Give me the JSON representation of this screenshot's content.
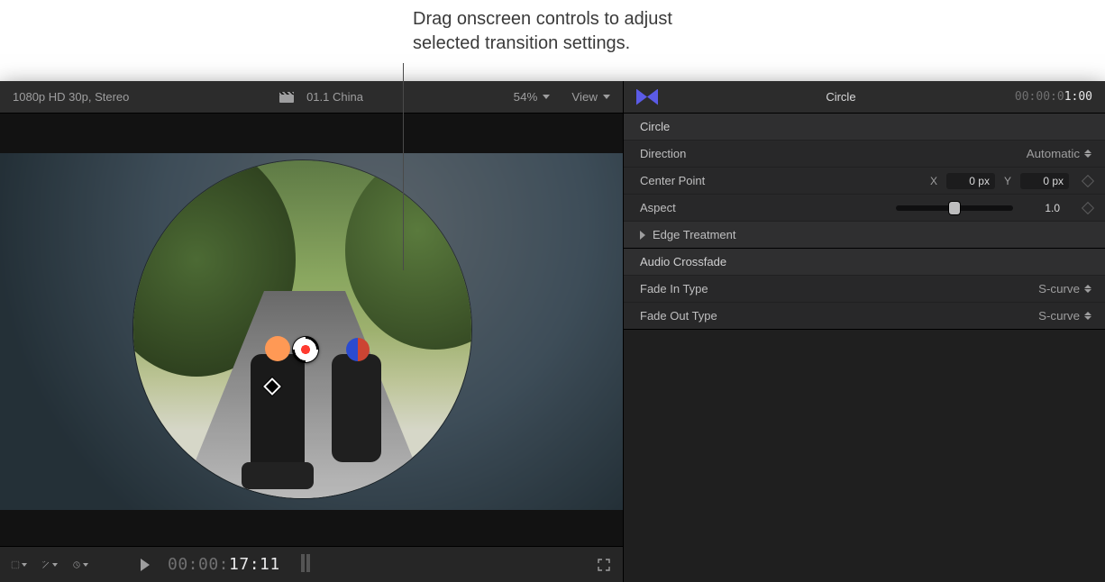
{
  "annotation": "Drag onscreen controls to adjust\nselected transition settings.",
  "viewer": {
    "format": "1080p HD 30p, Stereo",
    "clip_name": "01.1 China",
    "zoom": "54%",
    "view_label": "View",
    "timecode_dim": "00:00:",
    "timecode_hl": "17:11"
  },
  "inspector": {
    "title": "Circle",
    "tc_dim": "00:00:0",
    "tc_hl": "1:00",
    "sections": {
      "circle": {
        "heading": "Circle",
        "direction_label": "Direction",
        "direction_value": "Automatic",
        "center_label": "Center Point",
        "center_x_label": "X",
        "center_x_value": "0 px",
        "center_y_label": "Y",
        "center_y_value": "0 px",
        "aspect_label": "Aspect",
        "aspect_value": "1.0",
        "edge_label": "Edge Treatment"
      },
      "audio": {
        "heading": "Audio Crossfade",
        "fadein_label": "Fade In Type",
        "fadein_value": "S-curve",
        "fadeout_label": "Fade Out Type",
        "fadeout_value": "S-curve"
      }
    }
  }
}
